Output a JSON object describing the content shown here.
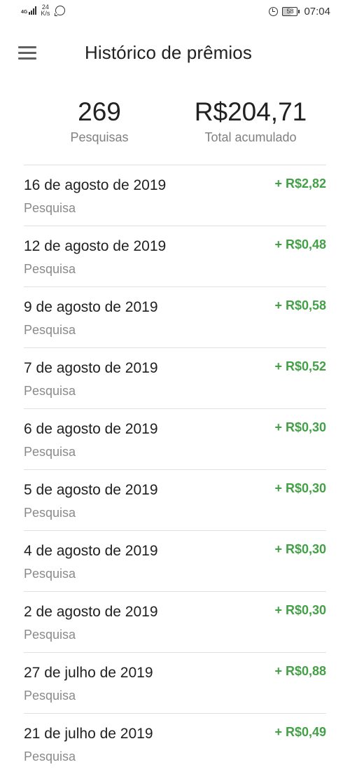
{
  "status_bar": {
    "network": "4G",
    "speed_value": "24",
    "speed_unit": "K/s",
    "battery": "58",
    "time": "07:04",
    "icons": [
      "signal-icon",
      "whatsapp-icon",
      "alarm-icon",
      "battery-icon"
    ]
  },
  "header": {
    "title": "Histórico de prêmios",
    "menu_icon": "hamburger-menu-icon"
  },
  "summary": {
    "count": "269",
    "count_label": "Pesquisas",
    "total": "R$204,71",
    "total_label": "Total acumulado"
  },
  "colors": {
    "amount_green": "#43a047",
    "secondary_text": "#8a8a8a",
    "divider": "#e0e0e0"
  },
  "history": [
    {
      "date": "16 de agosto de 2019",
      "type": "Pesquisa",
      "amount": "+ R$2,82"
    },
    {
      "date": "12 de agosto de 2019",
      "type": "Pesquisa",
      "amount": "+ R$0,48"
    },
    {
      "date": "9 de agosto de 2019",
      "type": "Pesquisa",
      "amount": "+ R$0,58"
    },
    {
      "date": "7 de agosto de 2019",
      "type": "Pesquisa",
      "amount": "+ R$0,52"
    },
    {
      "date": "6 de agosto de 2019",
      "type": "Pesquisa",
      "amount": "+ R$0,30"
    },
    {
      "date": "5 de agosto de 2019",
      "type": "Pesquisa",
      "amount": "+ R$0,30"
    },
    {
      "date": "4 de agosto de 2019",
      "type": "Pesquisa",
      "amount": "+ R$0,30"
    },
    {
      "date": "2 de agosto de 2019",
      "type": "Pesquisa",
      "amount": "+ R$0,30"
    },
    {
      "date": "27 de julho de 2019",
      "type": "Pesquisa",
      "amount": "+ R$0,88"
    },
    {
      "date": "21 de julho de 2019",
      "type": "Pesquisa",
      "amount": "+ R$0,49"
    }
  ]
}
